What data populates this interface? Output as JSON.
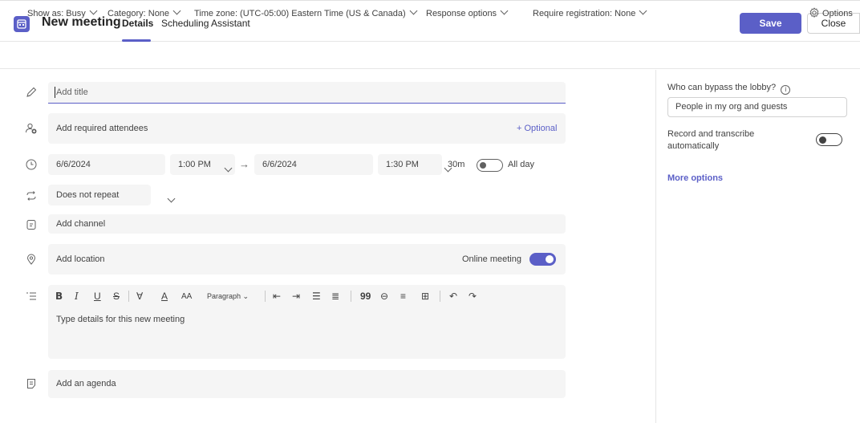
{
  "header": {
    "title": "New meeting",
    "tabs": [
      {
        "label": "Details",
        "active": true
      },
      {
        "label": "Scheduling Assistant",
        "active": false
      }
    ],
    "save_label": "Save",
    "close_label": "Close"
  },
  "options_bar": {
    "show_as": "Show as: Busy",
    "category": "Category: None",
    "time_zone": "Time zone: (UTC-05:00) Eastern Time (US & Canada)",
    "response_options": "Response options",
    "require_registration": "Require registration: None",
    "options": "Options"
  },
  "form": {
    "title_placeholder": "Add title",
    "attendees_placeholder": "Add required attendees",
    "optional_link": "+ Optional",
    "start_date": "6/6/2024",
    "start_time": "1:00 PM",
    "end_date": "6/6/2024",
    "end_time": "1:30 PM",
    "duration": "30m",
    "all_day_label": "All day",
    "all_day_on": false,
    "repeat": "Does not repeat",
    "channel_placeholder": "Add channel",
    "location_placeholder": "Add location",
    "online_meeting_label": "Online meeting",
    "online_meeting_on": true,
    "editor": {
      "paragraph_label": "Paragraph",
      "placeholder": "Type details for this new meeting"
    },
    "agenda_placeholder": "Add an agenda"
  },
  "side_panel": {
    "bypass_label": "Who can bypass the lobby?",
    "bypass_value": "People in my org and guests",
    "record_label": "Record and transcribe automatically",
    "record_on": false,
    "more_options": "More options"
  },
  "colors": {
    "accent": "#5b5fc7",
    "field_bg": "#f5f5f5",
    "border": "#e6e6e6"
  }
}
